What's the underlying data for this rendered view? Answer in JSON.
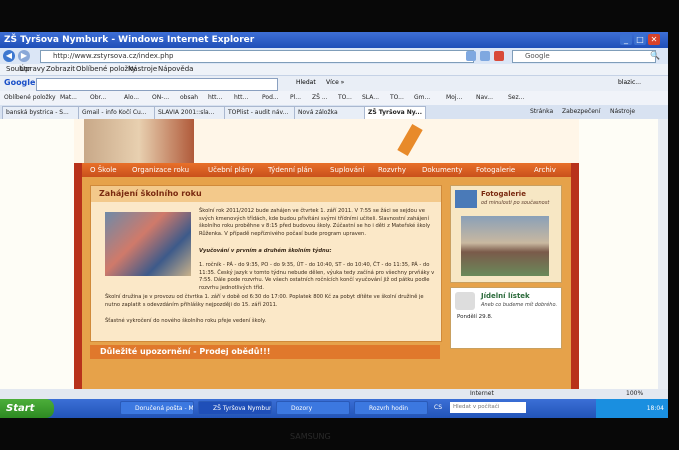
{
  "window": {
    "title": "ZŠ Tyršova Nymburk - Windows Internet Explorer"
  },
  "address": {
    "url": "http://www.zstyrsova.cz/index.php"
  },
  "search_engine": "Google",
  "menu": [
    "Soubor",
    "Úpravy",
    "Zobrazit",
    "Oblíbené položky",
    "Nástroje",
    "Nápověda"
  ],
  "google_bar": {
    "logo": "Google",
    "search_button": "Hledat",
    "more": "Více »",
    "user": "blazic..."
  },
  "favorites": {
    "label": "Oblíbené položky",
    "items": [
      "Mat...",
      "Obr...",
      "Alo...",
      "ON-...",
      "obsah",
      "htt...",
      "htt...",
      "Pod...",
      "Pl...",
      "ZŠ ...",
      "TO...",
      "SLA...",
      "TO...",
      "Gm...",
      "Moj...",
      "Nav...",
      "Sez..."
    ]
  },
  "tabs": [
    "banská bystrica - S...",
    "Gmail - info Kočí Cu...",
    "SLAVIA 2001::sla...",
    "TOPlist - audit náv...",
    "Nová záložka",
    "ZŠ Tyršova Ny..."
  ],
  "command_bar": [
    "Stránka",
    "Zabezpečení",
    "Nástroje"
  ],
  "site": {
    "nav": [
      "O Škole",
      "Organizace roku",
      "Učební plány",
      "Týdenní plán",
      "Suplování",
      "Rozvrhy",
      "Dokumenty",
      "Fotogalerie",
      "Archiv"
    ],
    "article": {
      "heading": "Zahájení školního roku",
      "p1": "Školní rok 2011/2012 bude zahájen ve čtvrtek 1. září 2011. V 7:55 se žáci se sejdou ve svých kmenových třídách, kde budou přivítáni svými třídními učiteli. Slavnostní zahájení školního roku proběhne v 8:15 před budovou školy. Zúčastní se ho i děti z Mateřské školy Růženka. V případě nepříznivého počasí bude program upraven.",
      "p2": "Vyučování v prvním a druhém školním týdnu:",
      "p3": "1. ročník - PÁ - do 9:35, PO - do 9:35, ÚT - do 10:40, ST - do 10:40, ČT - do 11:35, PÁ - do 11:35. Český jazyk v tomto týdnu nebude dělen, výuka tedy začíná pro všechny prvňáky v 7:55. Dále pode rozvrhu. Ve všech ostatních ročnících končí vyučování již od pátku podle rozvrhu jednotlivých tříd.",
      "p4": "Školní družina je v provozu od čtvrtka 1. září v době od 6:30 do 17:00. Poplatek 800 Kč za pobyt dítěte ve školní družině je nutno zaplatit s odevzdáním přihlášky nejpozději do 15. září 2011.",
      "p5": "Šťastné vykročení do nového školního roku přeje vedení školy."
    },
    "gallery": {
      "title": "Fotogalerie",
      "subtitle": "od minulosti po současnost"
    },
    "menu_box": {
      "title": "Jídelní lístek",
      "subtitle": "Aneb co budeme mít dobrého.",
      "day": "Pondělí 29.8."
    },
    "warning": "Důležité upozornění - Prodej obědů!!!"
  },
  "status": {
    "zone": "Internet",
    "zoom": "100%"
  },
  "taskbar": {
    "start": "Start",
    "tasks": [
      "Doručená pošta - M...",
      "ZŠ Tyršova Nymbur...",
      "Dozory",
      "Rozvrh hodin"
    ],
    "lang": "CS",
    "search_placeholder": "Hledat v počítači",
    "clock": "18:04"
  },
  "reflection_text": "SAMSUNG"
}
